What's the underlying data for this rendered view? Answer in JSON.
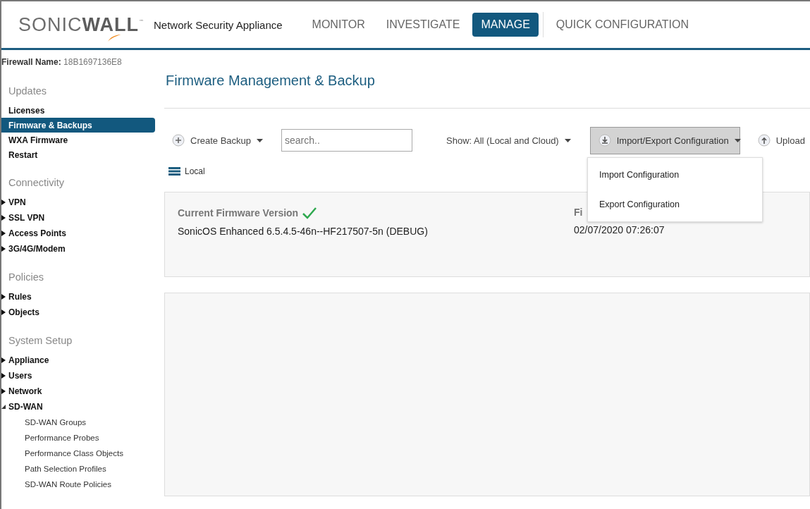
{
  "header": {
    "logo": "SONIC**WALL**",
    "logo_mark": "™",
    "product": "Network Security Appliance",
    "nav": [
      {
        "label": "MONITOR",
        "selected": false
      },
      {
        "label": "INVESTIGATE",
        "selected": false
      },
      {
        "label": "MANAGE",
        "selected": true
      },
      {
        "label": "QUICK CONFIGURATION",
        "selected": false
      }
    ]
  },
  "sidebar": {
    "firewall_label": "Firewall Name:",
    "firewall_name": "18B1697136E8",
    "sections": [
      {
        "heading": "Updates",
        "items": [
          {
            "label": "Licenses",
            "kind": "leaf",
            "selected": false
          },
          {
            "label": "Firmware & Backups",
            "kind": "leaf",
            "selected": true
          },
          {
            "label": "WXA Firmware",
            "kind": "leaf",
            "selected": false
          },
          {
            "label": "Restart",
            "kind": "leaf",
            "selected": false
          }
        ]
      },
      {
        "heading": "Connectivity",
        "items": [
          {
            "label": "VPN",
            "kind": "group",
            "expanded": false
          },
          {
            "label": "SSL VPN",
            "kind": "group",
            "expanded": false
          },
          {
            "label": "Access Points",
            "kind": "group",
            "expanded": false
          },
          {
            "label": "3G/4G/Modem",
            "kind": "group",
            "expanded": false
          }
        ]
      },
      {
        "heading": "Policies",
        "items": [
          {
            "label": "Rules",
            "kind": "group",
            "expanded": false
          },
          {
            "label": "Objects",
            "kind": "group",
            "expanded": false
          }
        ]
      },
      {
        "heading": "System Setup",
        "items": [
          {
            "label": "Appliance",
            "kind": "group",
            "expanded": false
          },
          {
            "label": "Users",
            "kind": "group",
            "expanded": false
          },
          {
            "label": "Network",
            "kind": "group",
            "expanded": false
          },
          {
            "label": "SD-WAN",
            "kind": "group",
            "expanded": true,
            "children": [
              {
                "label": "SD-WAN Groups"
              },
              {
                "label": "Performance Probes"
              },
              {
                "label": "Performance Class Objects"
              },
              {
                "label": "Path Selection Profiles"
              },
              {
                "label": "SD-WAN Route Policies"
              }
            ]
          }
        ]
      }
    ]
  },
  "page": {
    "title": "Firmware Management & Backup",
    "toolbar": {
      "create_backup": "Create Backup",
      "search": {
        "placeholder": "search.."
      },
      "show_filter": "Show: All (Local and Cloud)",
      "import_export": "Import/Export Configuration",
      "upload": "Upload"
    },
    "menu": {
      "items": [
        {
          "label": "Import Configuration"
        },
        {
          "label": "Export Configuration"
        }
      ]
    },
    "local_label": "Local",
    "firmware": {
      "current_heading": "Current Firmware Version",
      "current_value": "SonicOS Enhanced 6.5.4.5-46n--HF217507-5n (DEBUG)",
      "column_2_heading": "Fi",
      "column_2_value": "02/07/2020 07:26:07"
    }
  }
}
